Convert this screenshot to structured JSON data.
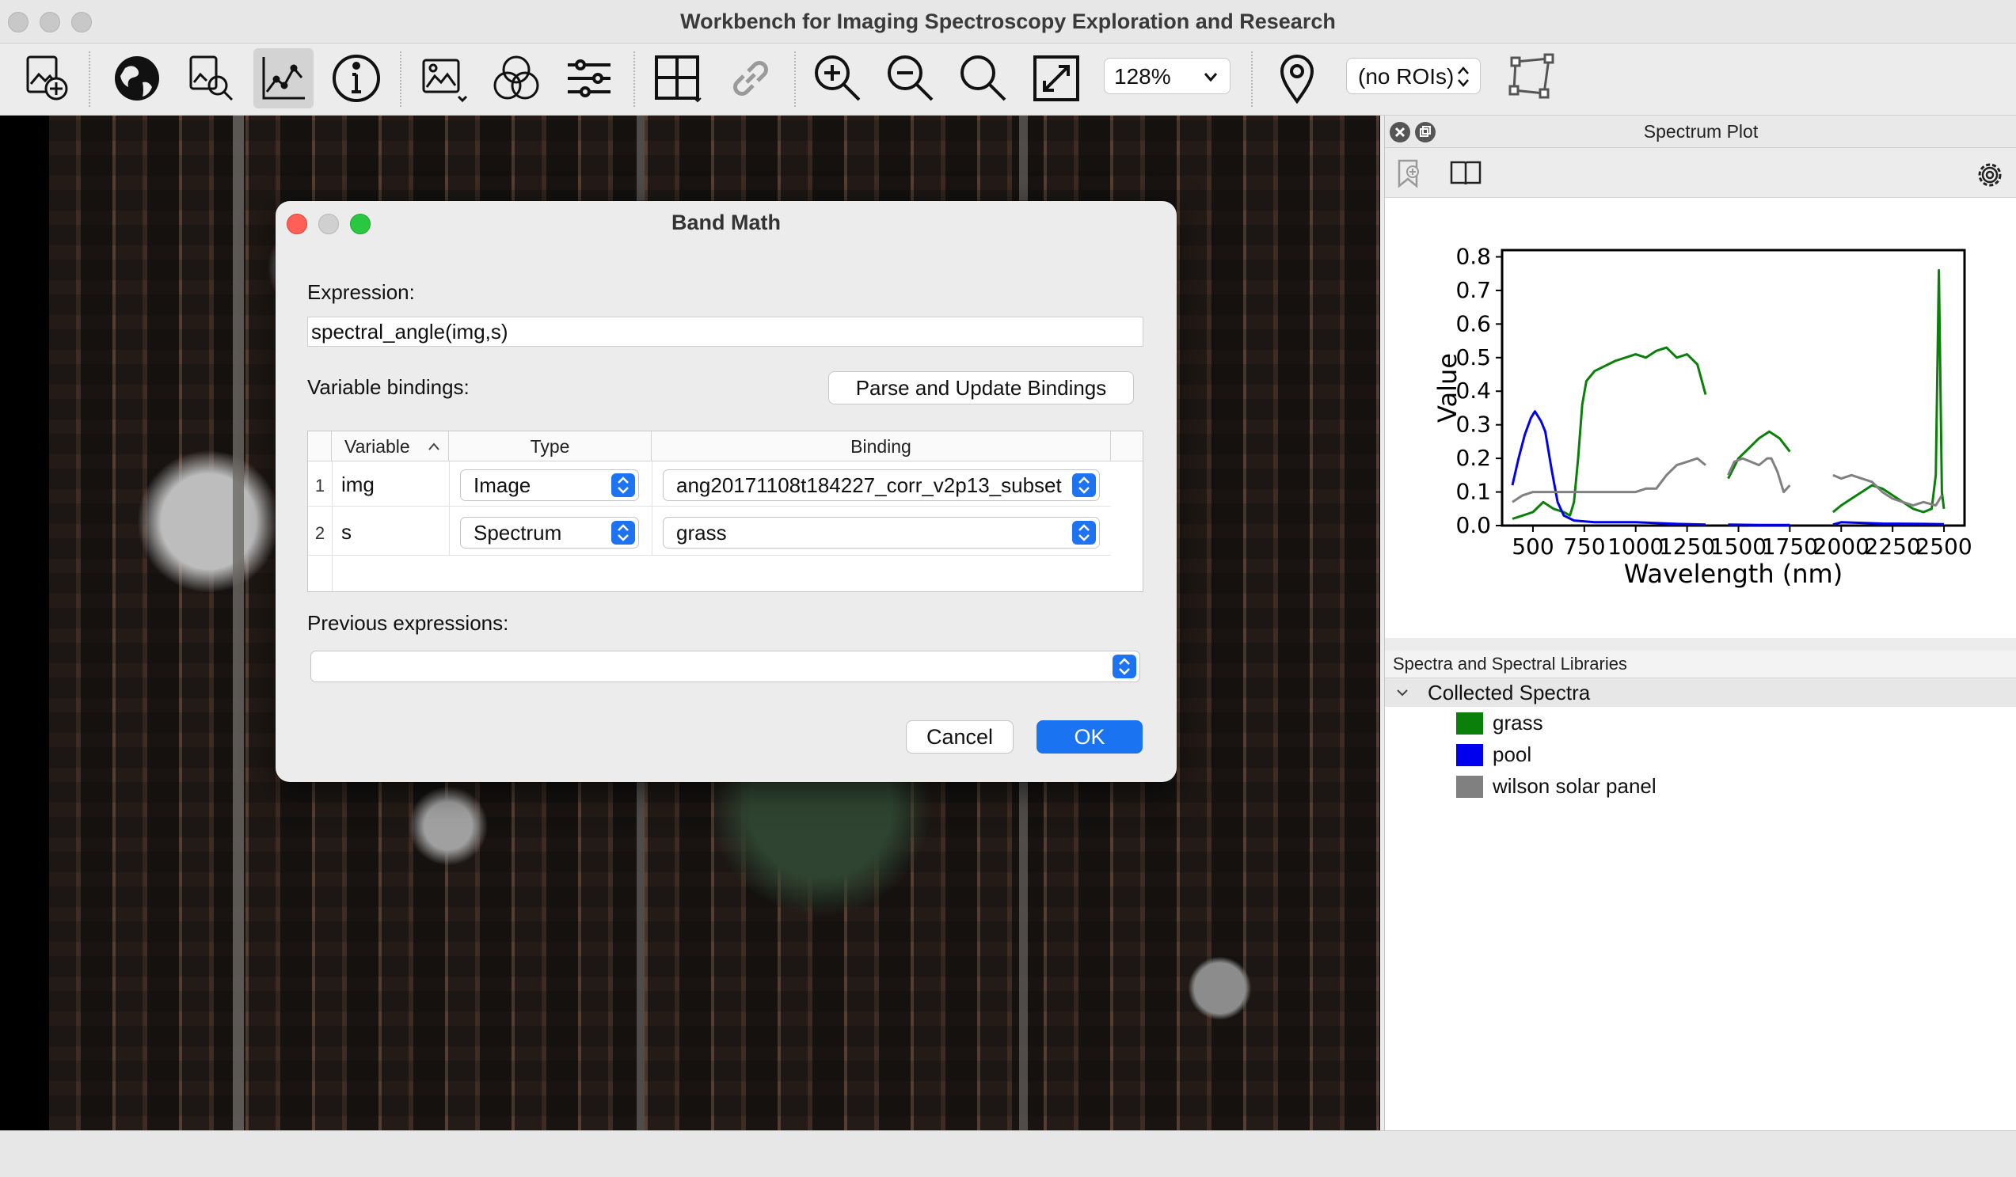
{
  "app": {
    "title": "Workbench for Imaging Spectroscopy Exploration and Research"
  },
  "toolbar": {
    "zoom_value": "128%",
    "roi_select": "(no ROIs)",
    "icons": [
      "add-dataset-icon",
      "globe-icon",
      "zoom-search-icon",
      "spectrum-plot-icon",
      "info-icon",
      "image-stretch-icon",
      "color-bands-icon",
      "sliders-icon",
      "grid-layout-icon",
      "link-icon",
      "zoom-in-icon",
      "zoom-out-icon",
      "zoom-fit-icon",
      "fullscreen-icon",
      "location-pin-icon",
      "polygon-roi-icon"
    ]
  },
  "dialog": {
    "title": "Band Math",
    "expression_label": "Expression:",
    "expression_value": "spectral_angle(img,s)",
    "bindings_label": "Variable bindings:",
    "parse_button": "Parse and Update Bindings",
    "columns": [
      "Variable",
      "Type",
      "Binding"
    ],
    "rows": [
      {
        "num": "1",
        "variable": "img",
        "type": "Image",
        "binding": "ang20171108t184227_corr_v2p13_subset"
      },
      {
        "num": "2",
        "variable": "s",
        "type": "Spectrum",
        "binding": "grass"
      }
    ],
    "previous_label": "Previous expressions:",
    "previous_value": "",
    "cancel_button": "Cancel",
    "ok_button": "OK"
  },
  "spectrum_panel": {
    "title": "Spectrum Plot",
    "library_header": "Spectra and Spectral Libraries",
    "group_label": "Collected Spectra",
    "items": [
      {
        "label": "grass",
        "color": "#0a7f0a"
      },
      {
        "label": "pool",
        "color": "#0000ee"
      },
      {
        "label": "wilson solar panel",
        "color": "#808080"
      }
    ]
  },
  "chart_data": {
    "type": "line",
    "xlabel": "Wavelength (nm)",
    "ylabel": "Value",
    "xlim": [
      350,
      2600
    ],
    "ylim": [
      0,
      0.82
    ],
    "xticks": [
      500,
      750,
      1000,
      1250,
      1500,
      1750,
      2000,
      2250,
      2500
    ],
    "xtick_labels": [
      "500",
      "750",
      "1000",
      "1250",
      "1500",
      "1750",
      "2000",
      "2250",
      "2500"
    ],
    "yticks": [
      0.0,
      0.1,
      0.2,
      0.3,
      0.4,
      0.5,
      0.6,
      0.7,
      0.8
    ],
    "ytick_labels": [
      "0.0",
      "0.1",
      "0.2",
      "0.3",
      "0.4",
      "0.5",
      "0.6",
      "0.7",
      "0.8"
    ],
    "series": [
      {
        "name": "grass",
        "color": "#0a7f0a",
        "segments": [
          [
            [
              400,
              0.02
            ],
            [
              450,
              0.03
            ],
            [
              500,
              0.04
            ],
            [
              550,
              0.07
            ],
            [
              600,
              0.05
            ],
            [
              650,
              0.04
            ],
            [
              680,
              0.03
            ],
            [
              700,
              0.07
            ],
            [
              720,
              0.2
            ],
            [
              740,
              0.36
            ],
            [
              760,
              0.43
            ],
            [
              800,
              0.46
            ],
            [
              900,
              0.49
            ],
            [
              1000,
              0.51
            ],
            [
              1050,
              0.5
            ],
            [
              1100,
              0.52
            ],
            [
              1150,
              0.53
            ],
            [
              1200,
              0.5
            ],
            [
              1250,
              0.51
            ],
            [
              1300,
              0.48
            ],
            [
              1340,
              0.39
            ]
          ],
          [
            [
              1450,
              0.14
            ],
            [
              1500,
              0.2
            ],
            [
              1550,
              0.23
            ],
            [
              1600,
              0.26
            ],
            [
              1650,
              0.28
            ],
            [
              1700,
              0.26
            ],
            [
              1750,
              0.22
            ]
          ],
          [
            [
              1960,
              0.04
            ],
            [
              2000,
              0.06
            ],
            [
              2050,
              0.08
            ],
            [
              2100,
              0.1
            ],
            [
              2150,
              0.12
            ],
            [
              2200,
              0.11
            ],
            [
              2250,
              0.09
            ],
            [
              2300,
              0.07
            ],
            [
              2350,
              0.05
            ],
            [
              2400,
              0.04
            ],
            [
              2440,
              0.05
            ],
            [
              2460,
              0.15
            ],
            [
              2475,
              0.76
            ],
            [
              2490,
              0.1
            ],
            [
              2500,
              0.05
            ]
          ]
        ]
      },
      {
        "name": "pool",
        "color": "#0000ee",
        "segments": [
          [
            [
              400,
              0.12
            ],
            [
              430,
              0.2
            ],
            [
              460,
              0.27
            ],
            [
              490,
              0.32
            ],
            [
              510,
              0.34
            ],
            [
              540,
              0.31
            ],
            [
              560,
              0.28
            ],
            [
              590,
              0.17
            ],
            [
              620,
              0.07
            ],
            [
              650,
              0.03
            ],
            [
              700,
              0.015
            ],
            [
              800,
              0.01
            ],
            [
              1000,
              0.01
            ],
            [
              1200,
              0.005
            ],
            [
              1340,
              0.003
            ]
          ],
          [
            [
              1450,
              0.003
            ],
            [
              1600,
              0.002
            ],
            [
              1750,
              0.002
            ]
          ],
          [
            [
              1960,
              0.003
            ],
            [
              2000,
              0.01
            ],
            [
              2200,
              0.006
            ],
            [
              2400,
              0.005
            ],
            [
              2500,
              0.004
            ]
          ]
        ]
      },
      {
        "name": "wilson solar panel",
        "color": "#808080",
        "segments": [
          [
            [
              400,
              0.07
            ],
            [
              450,
              0.09
            ],
            [
              500,
              0.1
            ],
            [
              600,
              0.1
            ],
            [
              700,
              0.1
            ],
            [
              800,
              0.1
            ],
            [
              900,
              0.1
            ],
            [
              1000,
              0.1
            ],
            [
              1050,
              0.11
            ],
            [
              1100,
              0.11
            ],
            [
              1150,
              0.15
            ],
            [
              1200,
              0.18
            ],
            [
              1250,
              0.19
            ],
            [
              1300,
              0.2
            ],
            [
              1340,
              0.18
            ]
          ],
          [
            [
              1450,
              0.15
            ],
            [
              1480,
              0.19
            ],
            [
              1520,
              0.2
            ],
            [
              1560,
              0.19
            ],
            [
              1600,
              0.18
            ],
            [
              1640,
              0.2
            ],
            [
              1660,
              0.2
            ],
            [
              1690,
              0.16
            ],
            [
              1720,
              0.1
            ],
            [
              1750,
              0.12
            ]
          ],
          [
            [
              1960,
              0.15
            ],
            [
              2000,
              0.14
            ],
            [
              2050,
              0.15
            ],
            [
              2100,
              0.14
            ],
            [
              2150,
              0.13
            ],
            [
              2200,
              0.1
            ],
            [
              2250,
              0.08
            ],
            [
              2300,
              0.07
            ],
            [
              2350,
              0.06
            ],
            [
              2400,
              0.07
            ],
            [
              2460,
              0.06
            ],
            [
              2490,
              0.09
            ]
          ]
        ]
      }
    ]
  }
}
